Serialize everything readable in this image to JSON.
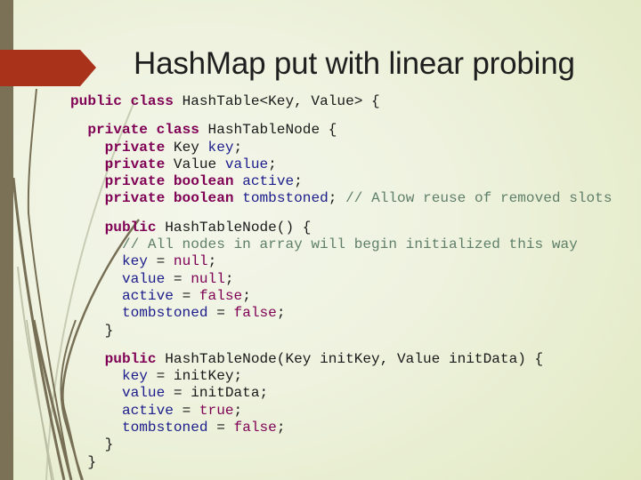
{
  "slide": {
    "title": "HashMap put with linear probing",
    "colors": {
      "sidebar": "#7a7157",
      "arrow": "#a8321a",
      "keyword": "#7f0055",
      "field": "#1c1c8c",
      "comment": "#5f7f6a",
      "text": "#1a1a1a"
    },
    "icons": {
      "title_marker": "arrow-right-banner-icon"
    }
  },
  "code": {
    "lines": [
      [
        {
          "t": "public class",
          "c": "kw"
        },
        {
          "t": " HashTable<Key, Value> {",
          "c": "txt"
        }
      ],
      [],
      [
        {
          "t": "  ",
          "c": "txt"
        },
        {
          "t": "private class",
          "c": "kw"
        },
        {
          "t": " HashTableNode {",
          "c": "txt"
        }
      ],
      [
        {
          "t": "    ",
          "c": "txt"
        },
        {
          "t": "private",
          "c": "kw"
        },
        {
          "t": " Key ",
          "c": "txt"
        },
        {
          "t": "key",
          "c": "fld"
        },
        {
          "t": ";",
          "c": "txt"
        }
      ],
      [
        {
          "t": "    ",
          "c": "txt"
        },
        {
          "t": "private",
          "c": "kw"
        },
        {
          "t": " Value ",
          "c": "txt"
        },
        {
          "t": "value",
          "c": "fld"
        },
        {
          "t": ";",
          "c": "txt"
        }
      ],
      [
        {
          "t": "    ",
          "c": "txt"
        },
        {
          "t": "private boolean",
          "c": "kw"
        },
        {
          "t": " ",
          "c": "txt"
        },
        {
          "t": "active",
          "c": "fld"
        },
        {
          "t": ";",
          "c": "txt"
        }
      ],
      [
        {
          "t": "    ",
          "c": "txt"
        },
        {
          "t": "private boolean",
          "c": "kw"
        },
        {
          "t": " ",
          "c": "txt"
        },
        {
          "t": "tombstoned",
          "c": "fld"
        },
        {
          "t": "; ",
          "c": "txt"
        },
        {
          "t": "// Allow reuse of removed slots",
          "c": "cmt"
        }
      ],
      [],
      [
        {
          "t": "    ",
          "c": "txt"
        },
        {
          "t": "public",
          "c": "kw"
        },
        {
          "t": " HashTableNode() {",
          "c": "txt"
        }
      ],
      [
        {
          "t": "      ",
          "c": "txt"
        },
        {
          "t": "// All nodes in array will begin initialized this way",
          "c": "cmt"
        }
      ],
      [
        {
          "t": "      ",
          "c": "txt"
        },
        {
          "t": "key",
          "c": "fld"
        },
        {
          "t": " = ",
          "c": "txt"
        },
        {
          "t": "null",
          "c": "lit"
        },
        {
          "t": ";",
          "c": "txt"
        }
      ],
      [
        {
          "t": "      ",
          "c": "txt"
        },
        {
          "t": "value",
          "c": "fld"
        },
        {
          "t": " = ",
          "c": "txt"
        },
        {
          "t": "null",
          "c": "lit"
        },
        {
          "t": ";",
          "c": "txt"
        }
      ],
      [
        {
          "t": "      ",
          "c": "txt"
        },
        {
          "t": "active",
          "c": "fld"
        },
        {
          "t": " = ",
          "c": "txt"
        },
        {
          "t": "false",
          "c": "lit"
        },
        {
          "t": ";",
          "c": "txt"
        }
      ],
      [
        {
          "t": "      ",
          "c": "txt"
        },
        {
          "t": "tombstoned",
          "c": "fld"
        },
        {
          "t": " = ",
          "c": "txt"
        },
        {
          "t": "false",
          "c": "lit"
        },
        {
          "t": ";",
          "c": "txt"
        }
      ],
      [
        {
          "t": "    }",
          "c": "txt"
        }
      ],
      [],
      [
        {
          "t": "    ",
          "c": "txt"
        },
        {
          "t": "public",
          "c": "kw"
        },
        {
          "t": " HashTableNode(Key initKey, Value initData) {",
          "c": "txt"
        }
      ],
      [
        {
          "t": "      ",
          "c": "txt"
        },
        {
          "t": "key",
          "c": "fld"
        },
        {
          "t": " = initKey;",
          "c": "txt"
        }
      ],
      [
        {
          "t": "      ",
          "c": "txt"
        },
        {
          "t": "value",
          "c": "fld"
        },
        {
          "t": " = initData;",
          "c": "txt"
        }
      ],
      [
        {
          "t": "      ",
          "c": "txt"
        },
        {
          "t": "active",
          "c": "fld"
        },
        {
          "t": " = ",
          "c": "txt"
        },
        {
          "t": "true",
          "c": "lit"
        },
        {
          "t": ";",
          "c": "txt"
        }
      ],
      [
        {
          "t": "      ",
          "c": "txt"
        },
        {
          "t": "tombstoned",
          "c": "fld"
        },
        {
          "t": " = ",
          "c": "txt"
        },
        {
          "t": "false",
          "c": "lit"
        },
        {
          "t": ";",
          "c": "txt"
        }
      ],
      [
        {
          "t": "    }",
          "c": "txt"
        }
      ],
      [
        {
          "t": "  }",
          "c": "txt"
        }
      ]
    ]
  }
}
